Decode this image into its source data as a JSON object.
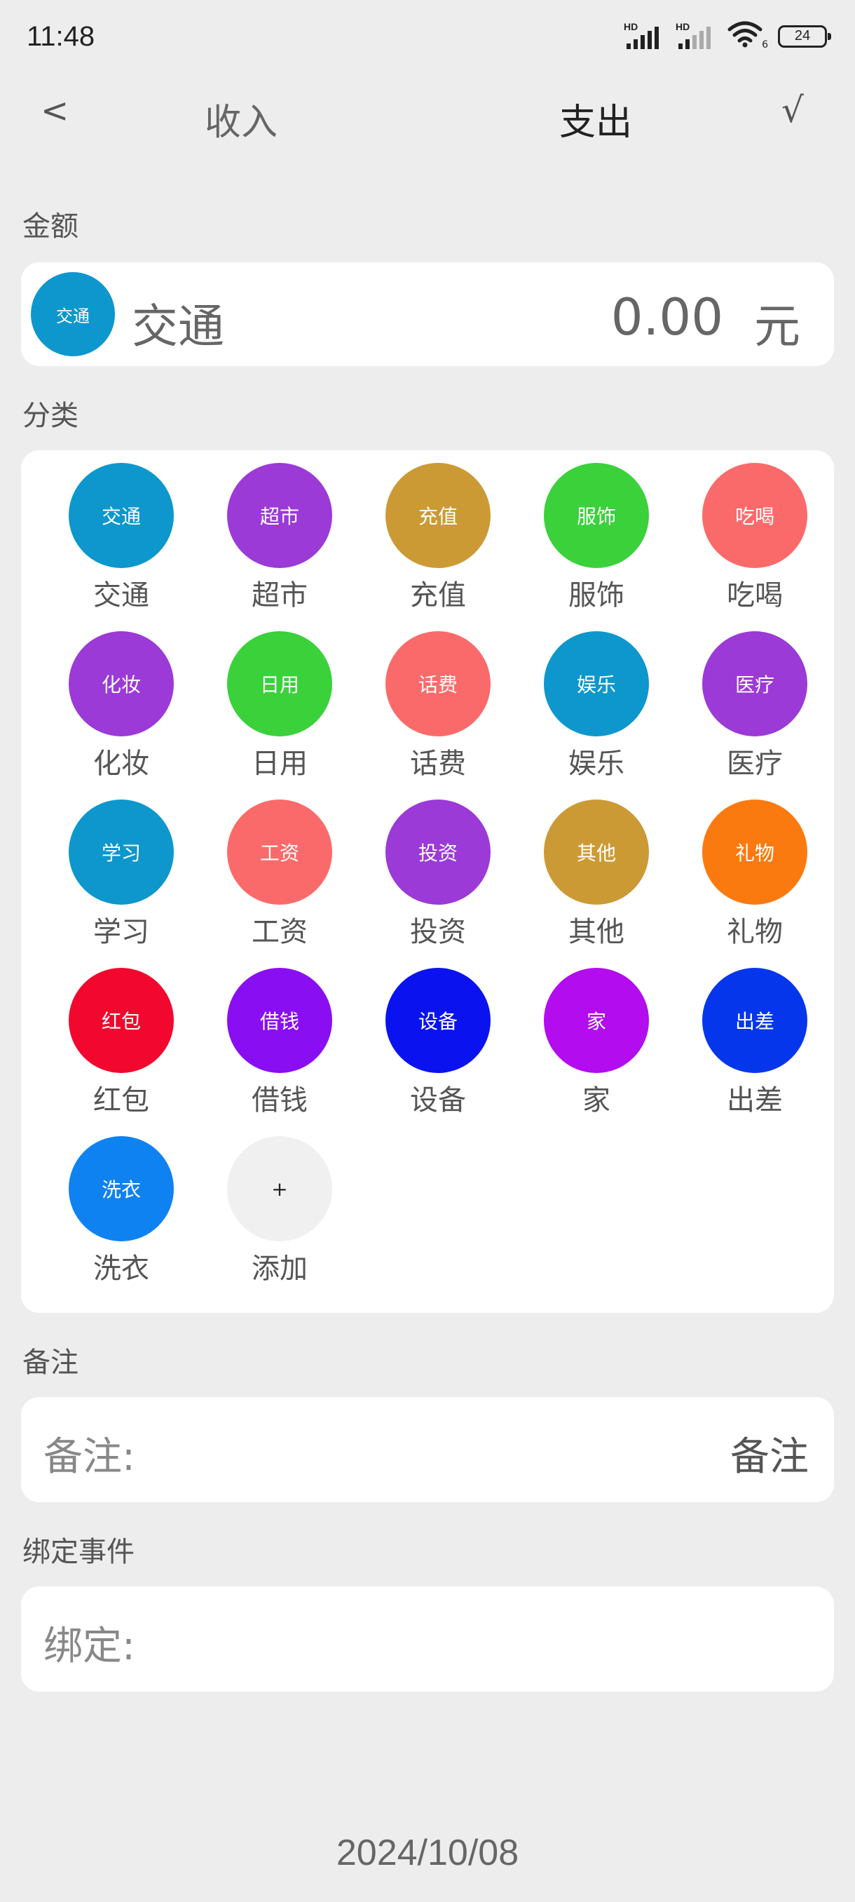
{
  "status_bar": {
    "time": "11:48",
    "signal1_label": "HD",
    "signal2_label": "HD",
    "wifi_badge": "6",
    "battery": "24"
  },
  "nav": {
    "back": "<",
    "income_tab": "收入",
    "expense_tab": "支出",
    "confirm": "√",
    "selected_tab": "支出"
  },
  "amount": {
    "section_label": "金额",
    "icon_text": "交通",
    "icon_color": "#0d97cc",
    "category_name": "交通",
    "value": "0.00",
    "unit": "元"
  },
  "category": {
    "section_label": "分类",
    "items": [
      {
        "icon_text": "交通",
        "label": "交通",
        "color": "#0d97cc"
      },
      {
        "icon_text": "超市",
        "label": "超市",
        "color": "#9b3ad6"
      },
      {
        "icon_text": "充值",
        "label": "充值",
        "color": "#cc9a35"
      },
      {
        "icon_text": "服饰",
        "label": "服饰",
        "color": "#3ad13a"
      },
      {
        "icon_text": "吃喝",
        "label": "吃喝",
        "color": "#fb6a6a"
      },
      {
        "icon_text": "化妆",
        "label": "化妆",
        "color": "#9b3ad6"
      },
      {
        "icon_text": "日用",
        "label": "日用",
        "color": "#3ad13a"
      },
      {
        "icon_text": "话费",
        "label": "话费",
        "color": "#fb6a6a"
      },
      {
        "icon_text": "娱乐",
        "label": "娱乐",
        "color": "#0d97cc"
      },
      {
        "icon_text": "医疗",
        "label": "医疗",
        "color": "#9b3ad6"
      },
      {
        "icon_text": "学习",
        "label": "学习",
        "color": "#0d97cc"
      },
      {
        "icon_text": "工资",
        "label": "工资",
        "color": "#fb6a6a"
      },
      {
        "icon_text": "投资",
        "label": "投资",
        "color": "#9b3ad6"
      },
      {
        "icon_text": "其他",
        "label": "其他",
        "color": "#cc9a35"
      },
      {
        "icon_text": "礼物",
        "label": "礼物",
        "color": "#fb7a0f"
      },
      {
        "icon_text": "红包",
        "label": "红包",
        "color": "#f2082e"
      },
      {
        "icon_text": "借钱",
        "label": "借钱",
        "color": "#8a0ef2"
      },
      {
        "icon_text": "设备",
        "label": "设备",
        "color": "#0a13ef"
      },
      {
        "icon_text": "家",
        "label": "家",
        "color": "#b20cef"
      },
      {
        "icon_text": "出差",
        "label": "出差",
        "color": "#0636ec"
      },
      {
        "icon_text": "洗衣",
        "label": "洗衣",
        "color": "#0f82f2"
      },
      {
        "icon_text": "+",
        "label": "添加",
        "color": "#f0f0f0",
        "text_color": "#222222"
      }
    ]
  },
  "note": {
    "section_label": "备注",
    "prefix": "备注:",
    "value": "备注"
  },
  "bind": {
    "section_label": "绑定事件",
    "prefix": "绑定:"
  },
  "date": "2024/10/08"
}
